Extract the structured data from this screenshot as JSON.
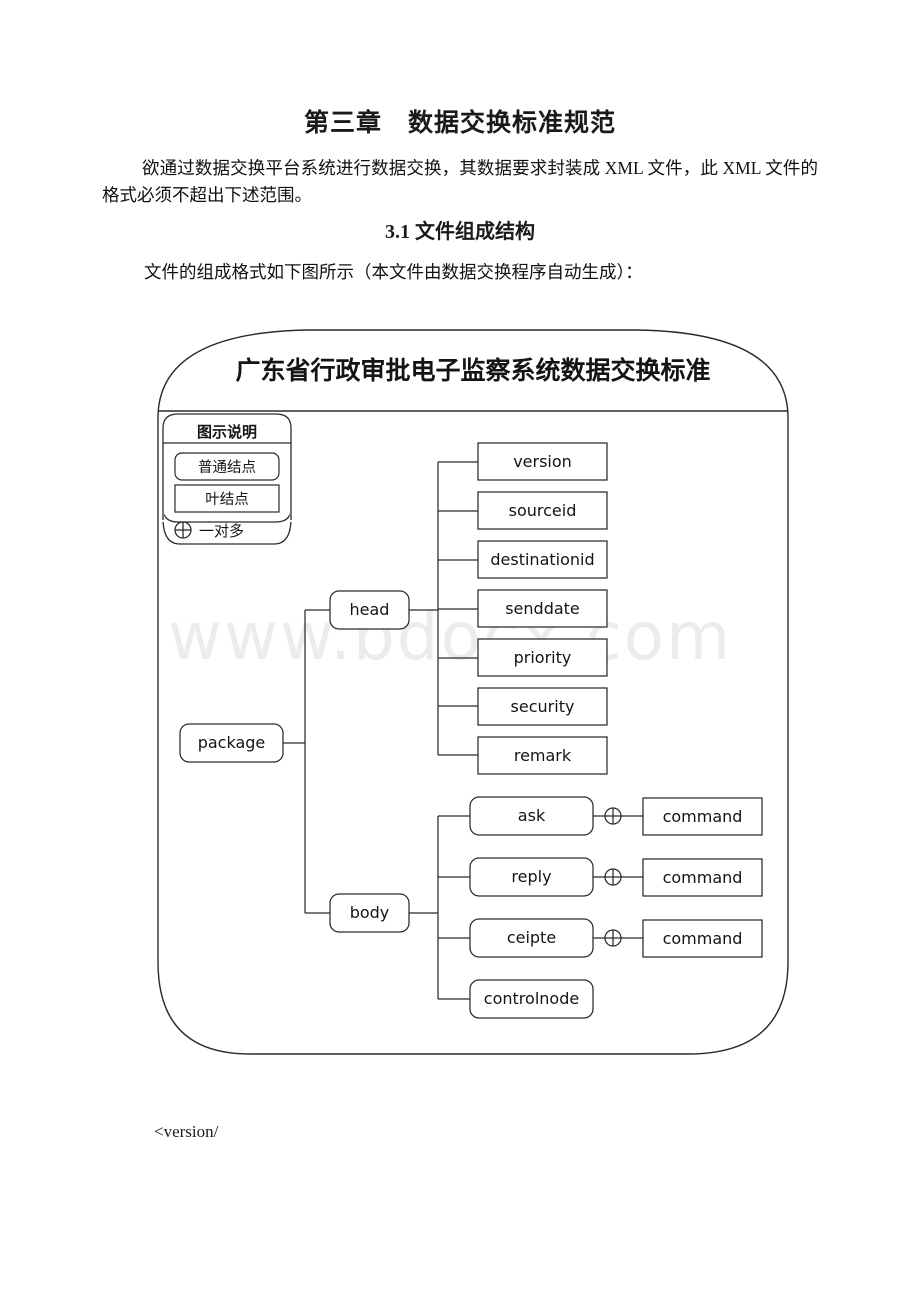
{
  "document": {
    "chapter_title_prefix": "第三章",
    "chapter_title_main": "数据交换标准规范",
    "paragraph_1": "欲通过数据交换平台系统进行数据交换，其数据要求封装成 XML 文件，此 XML 文件的格式必须不超出下述范围。",
    "section_title": "3.1 文件组成结构",
    "paragraph_2": "文件的组成格式如下图所示（本文件由数据交换程序自动生成）：",
    "bottom_code": "<version/",
    "watermark": "www.bdocx.com"
  },
  "diagram": {
    "title": "广东省行政审批电子监察系统数据交换标准",
    "legend": {
      "heading": "图示说明",
      "normal_node": "普通结点",
      "leaf_node": "叶结点",
      "one_to_many_symbol": "⊕",
      "one_to_many_label": "一对多"
    },
    "root": "package",
    "branches": [
      {
        "name": "head",
        "children": [
          {
            "label": "version",
            "type": "leaf"
          },
          {
            "label": "sourceid",
            "type": "leaf"
          },
          {
            "label": "destinationid",
            "type": "leaf"
          },
          {
            "label": "senddate",
            "type": "leaf"
          },
          {
            "label": "priority",
            "type": "leaf"
          },
          {
            "label": "security",
            "type": "leaf"
          },
          {
            "label": "remark",
            "type": "leaf"
          }
        ]
      },
      {
        "name": "body",
        "children": [
          {
            "label": "ask",
            "type": "normal",
            "multiplicity": "⊕",
            "child": "command"
          },
          {
            "label": "reply",
            "type": "normal",
            "multiplicity": "⊕",
            "child": "command"
          },
          {
            "label": "ceipte",
            "type": "normal",
            "multiplicity": "⊕",
            "child": "command"
          },
          {
            "label": "controlnode",
            "type": "normal"
          }
        ]
      }
    ],
    "colors": {
      "stroke": "#2a2a2a",
      "text": "#1a1a1a",
      "background": "#ffffff",
      "watermark": "#ececed"
    }
  }
}
